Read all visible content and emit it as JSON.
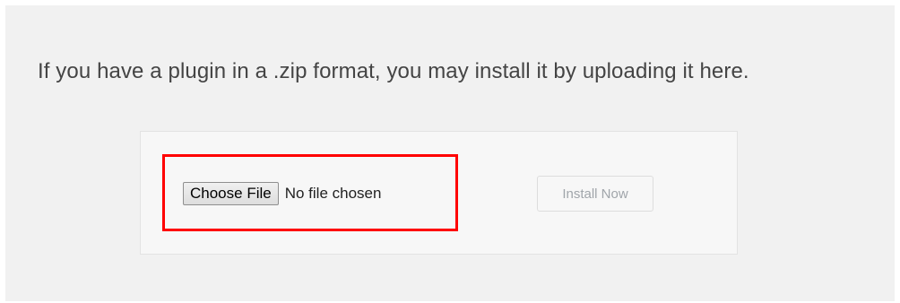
{
  "upload": {
    "help_text": "If you have a plugin in a .zip format, you may install it by uploading it here.",
    "choose_file_label": "Choose File",
    "file_status": "No file chosen",
    "install_button_label": "Install Now",
    "install_button_disabled": true
  },
  "colors": {
    "highlight": "#ff0000",
    "panel_background": "#f1f1f1",
    "form_background": "#f7f7f7",
    "disabled_text": "#a0a5aa"
  }
}
